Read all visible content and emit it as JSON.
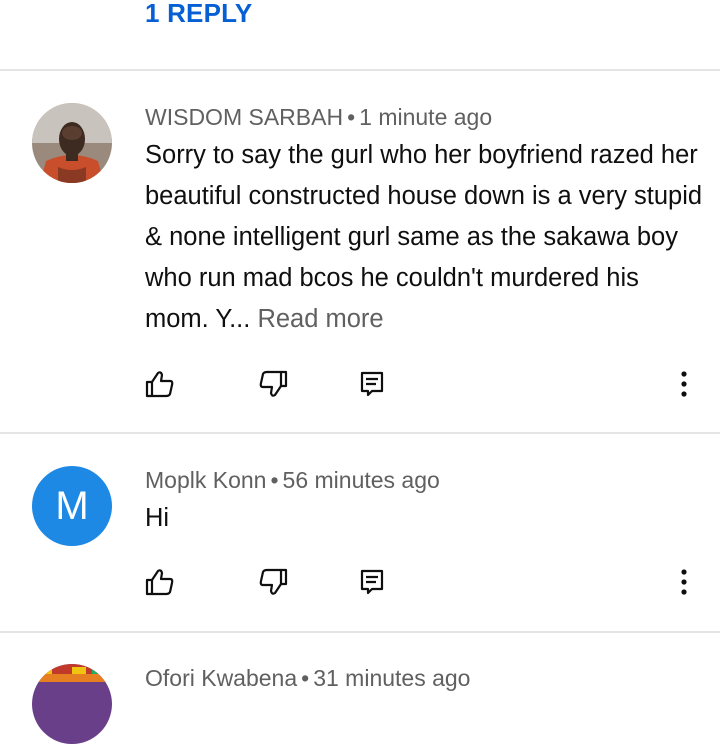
{
  "replies": {
    "label": "1 REPLY"
  },
  "comments": [
    {
      "author": "WISDOM SARBAH",
      "separator": "•",
      "time": "1 minute ago",
      "text": "Sorry to say the gurl who her boyfriend razed her beautiful constructed house down is a very stupid & none intelligent gurl same as the sakawa boy who run mad bcos he couldn't murdered his mom. Y...",
      "read_more": "Read more"
    },
    {
      "author": "Moplk Konn",
      "separator": "•",
      "time": "56 minutes ago",
      "avatar_letter": "M",
      "text": "Hi"
    },
    {
      "author": "Ofori Kwabena",
      "separator": "•",
      "time": "31 minutes ago"
    }
  ],
  "icons": [
    "thumbs-up-icon",
    "thumbs-down-icon",
    "reply-icon",
    "more-vert-icon"
  ],
  "colors": {
    "link": "#065fd4",
    "meta": "#606060",
    "avatar_m": "#1e88e5"
  }
}
